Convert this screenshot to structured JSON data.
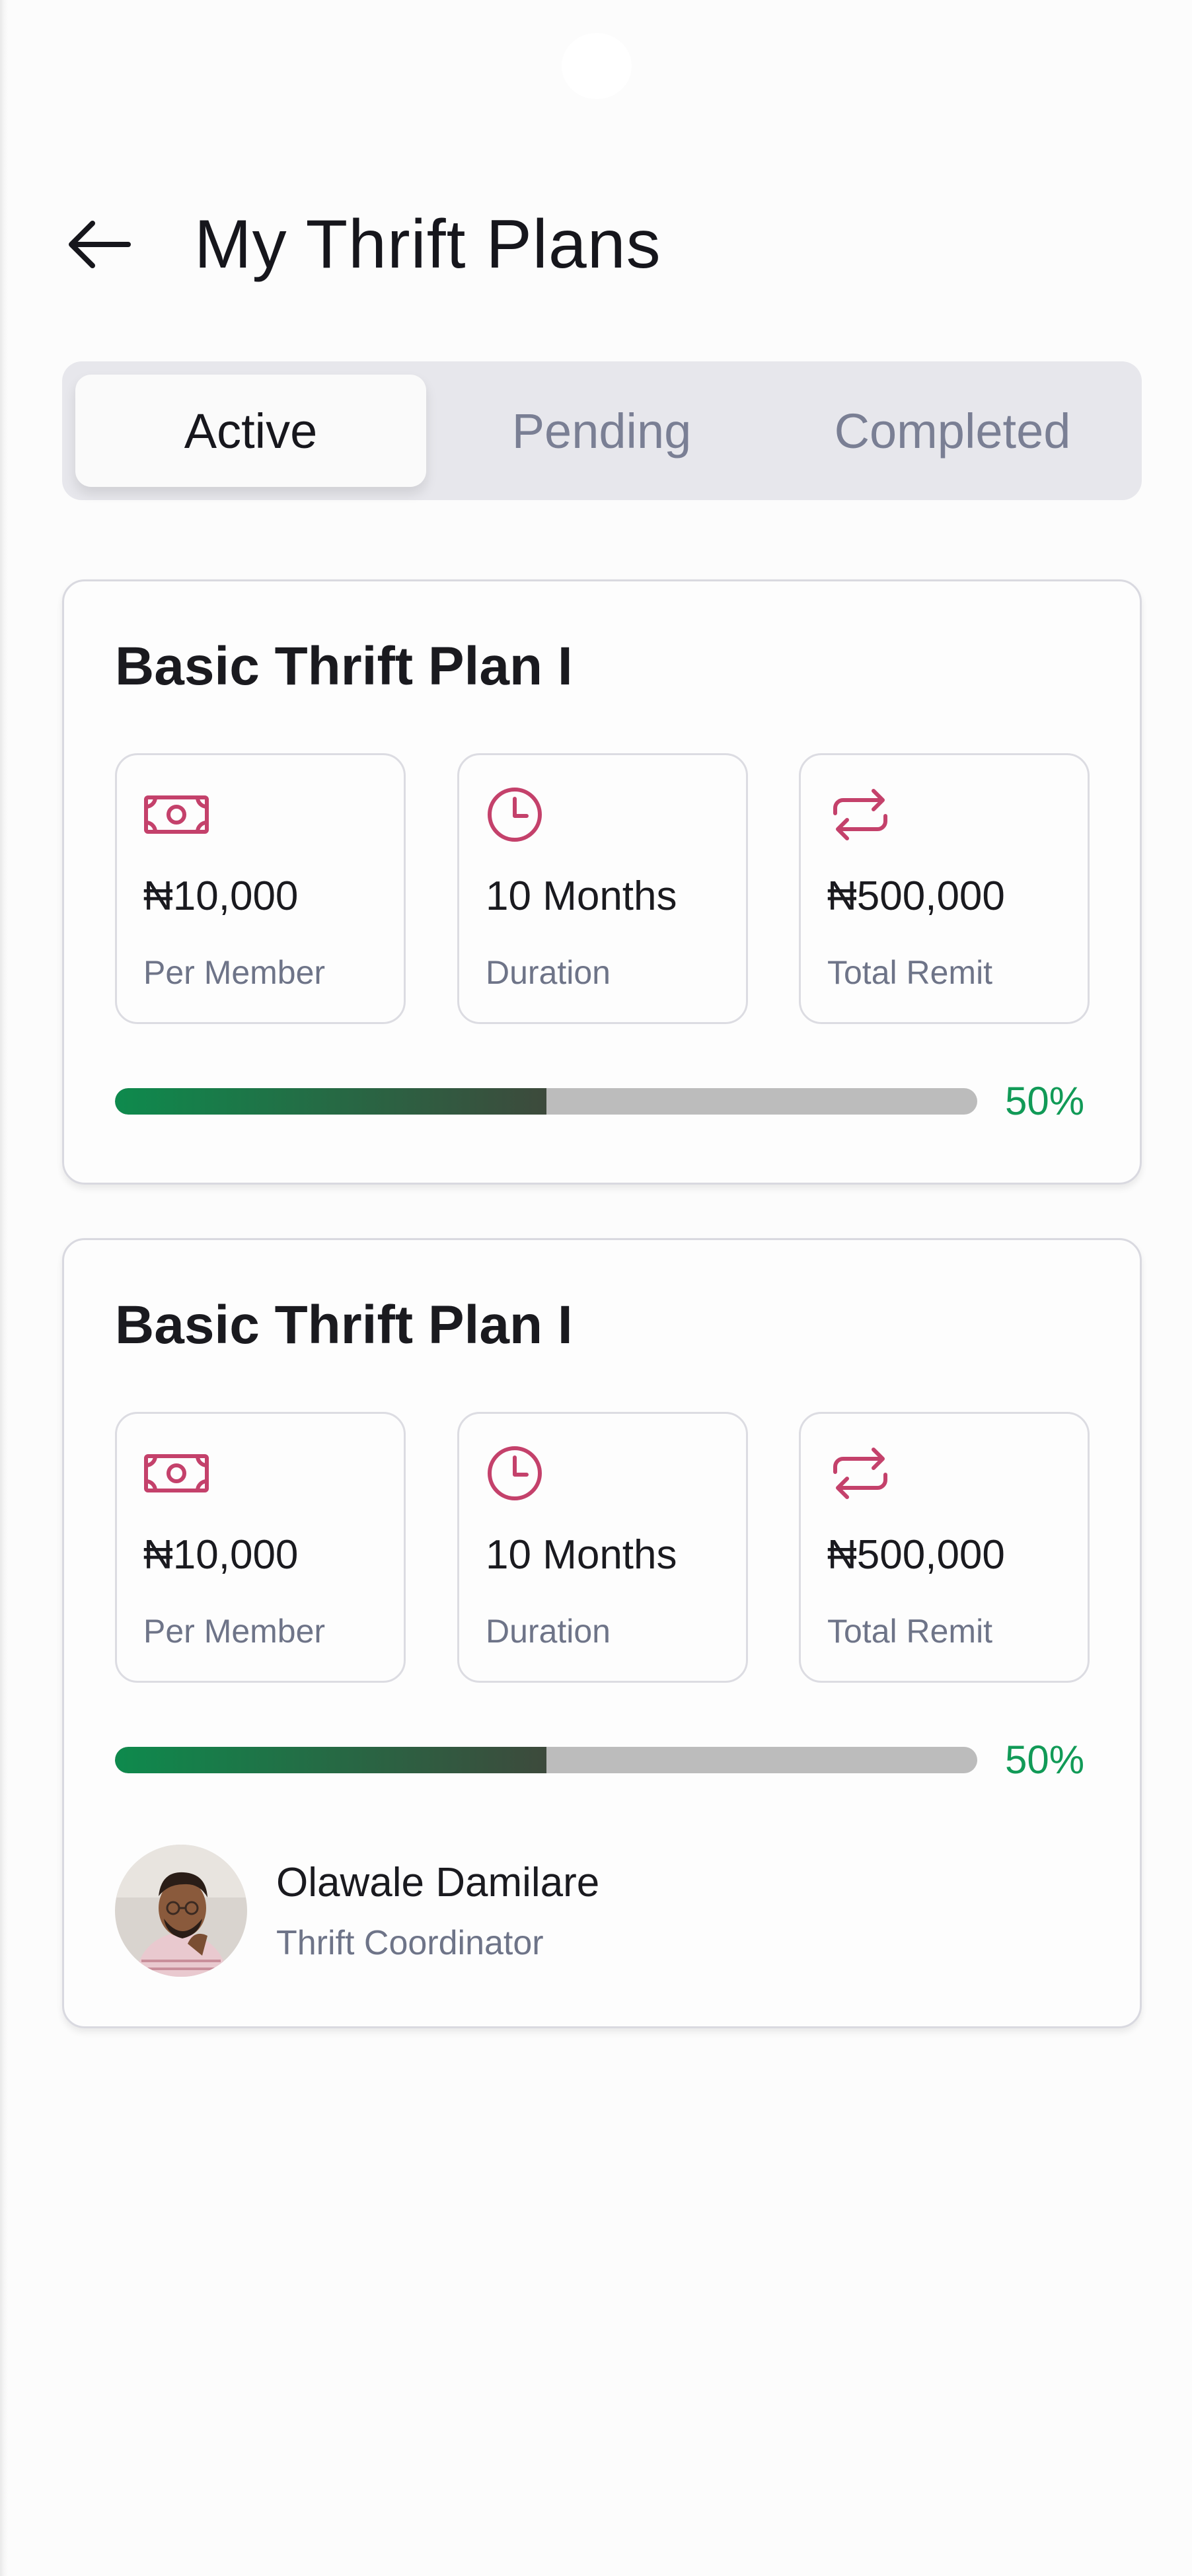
{
  "header": {
    "title": "My Thrift Plans",
    "back_icon": "arrow-left-icon"
  },
  "tabs": [
    {
      "label": "Active",
      "selected": true
    },
    {
      "label": "Pending",
      "selected": false
    },
    {
      "label": "Completed",
      "selected": false
    }
  ],
  "plans": [
    {
      "title": "Basic Thrift Plan I",
      "stats": [
        {
          "icon": "cash-icon",
          "value": "₦10,000",
          "label": "Per Member"
        },
        {
          "icon": "clock-icon",
          "value": "10 Months",
          "label": "Duration"
        },
        {
          "icon": "repeat-icon",
          "value": "₦500,000",
          "label": "Total Remit"
        }
      ],
      "progress": {
        "percent": 50,
        "label": "50%"
      }
    },
    {
      "title": "Basic Thrift Plan I",
      "stats": [
        {
          "icon": "cash-icon",
          "value": "₦10,000",
          "label": "Per Member"
        },
        {
          "icon": "clock-icon",
          "value": "10 Months",
          "label": "Duration"
        },
        {
          "icon": "repeat-icon",
          "value": "₦500,000",
          "label": "Total Remit"
        }
      ],
      "progress": {
        "percent": 50,
        "label": "50%"
      },
      "coordinator": {
        "name": "Olawale Damilare",
        "role": "Thrift Coordinator"
      }
    }
  ],
  "colors": {
    "accent_icon": "#c4416b",
    "progress_green": "#0e8a4d",
    "progress_text": "#119a57",
    "tab_background": "#e7e7ec"
  }
}
